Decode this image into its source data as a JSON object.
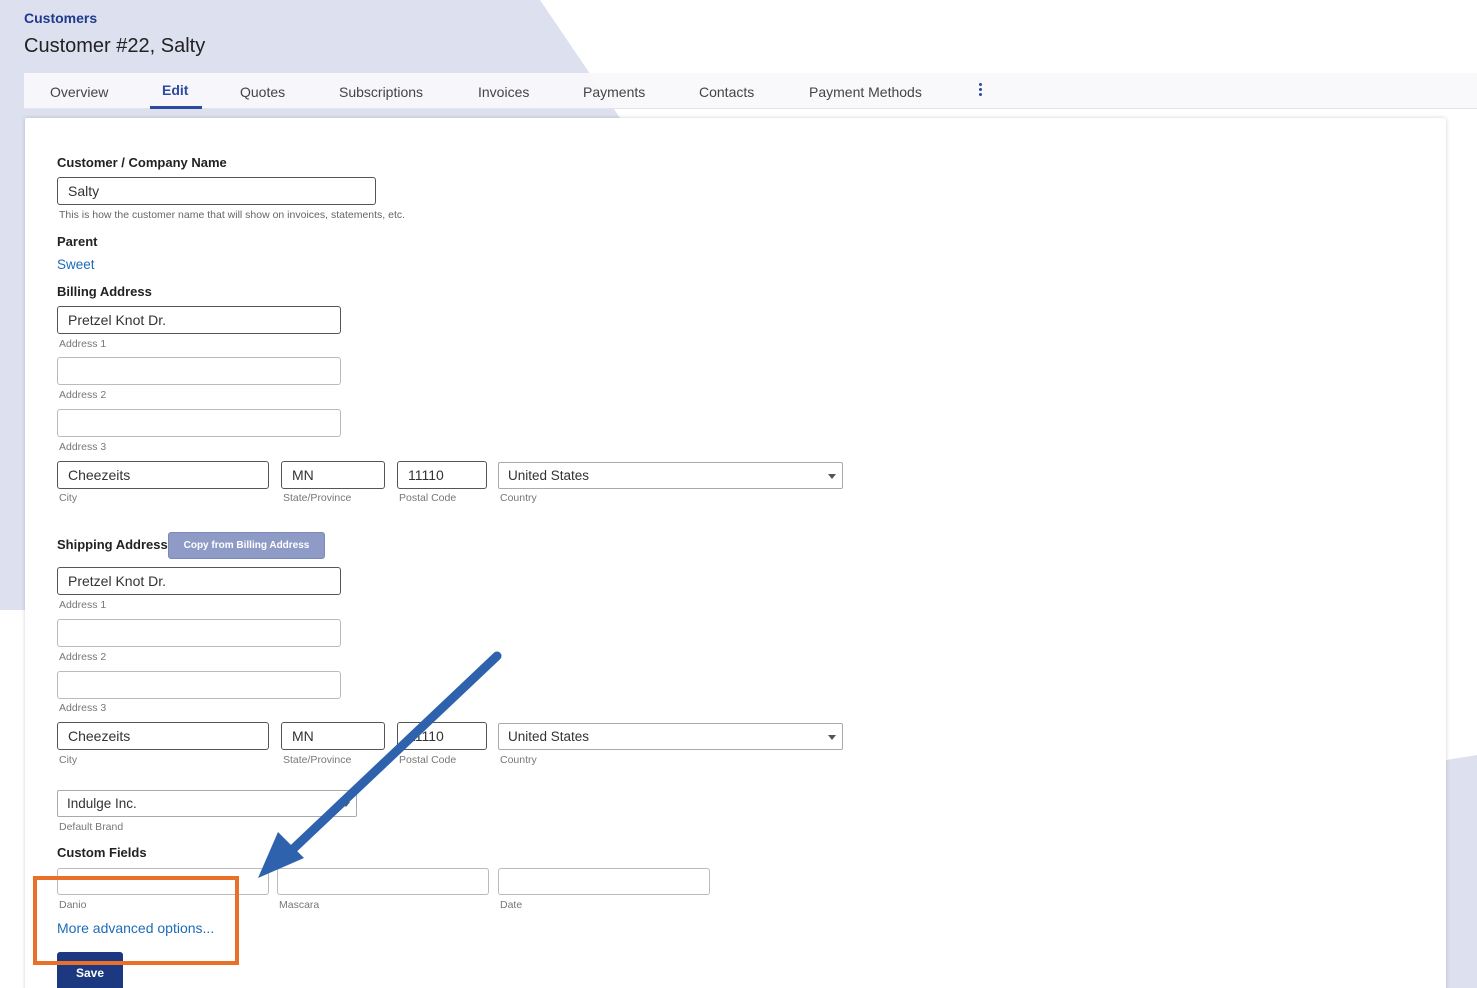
{
  "breadcrumb": "Customers",
  "page_title": "Customer #22, Salty",
  "tabs": [
    {
      "label": "Overview"
    },
    {
      "label": "Edit"
    },
    {
      "label": "Quotes"
    },
    {
      "label": "Subscriptions"
    },
    {
      "label": "Invoices"
    },
    {
      "label": "Payments"
    },
    {
      "label": "Contacts"
    },
    {
      "label": "Payment Methods"
    }
  ],
  "form": {
    "name_label": "Customer / Company Name",
    "name_value": "Salty",
    "name_hint": "This is how the customer name that will show on invoices, statements, etc.",
    "parent_label": "Parent",
    "parent_link": "Sweet",
    "billing": {
      "label": "Billing Address",
      "address1": "Pretzel Knot Dr.",
      "address1_label": "Address 1",
      "address2": "",
      "address2_label": "Address 2",
      "address3": "",
      "address3_label": "Address 3",
      "city": "Cheezeits",
      "city_label": "City",
      "state": "MN",
      "state_label": "State/Province",
      "postal": "11110",
      "postal_label": "Postal Code",
      "country": "United States",
      "country_label": "Country"
    },
    "shipping": {
      "label": "Shipping Address",
      "copy_button": "Copy from Billing Address",
      "address1": "Pretzel Knot Dr.",
      "address1_label": "Address 1",
      "address2": "",
      "address2_label": "Address 2",
      "address3": "",
      "address3_label": "Address 3",
      "city": "Cheezeits",
      "city_label": "City",
      "state": "MN",
      "state_label": "State/Province",
      "postal": "11110",
      "postal_label": "Postal Code",
      "country": "United States",
      "country_label": "Country"
    },
    "brand": {
      "value": "Indulge Inc.",
      "label": "Default Brand"
    },
    "custom_fields": {
      "label": "Custom Fields",
      "fields": [
        {
          "label": "Danio",
          "value": ""
        },
        {
          "label": "Mascara",
          "value": ""
        },
        {
          "label": "Date",
          "value": ""
        }
      ]
    },
    "advanced_link": "More advanced options...",
    "save_button": "Save"
  },
  "colors": {
    "accent": "#2b4aa0",
    "link": "#1e6bb8",
    "highlight": "#e8702a",
    "arrow": "#2f62ad"
  }
}
